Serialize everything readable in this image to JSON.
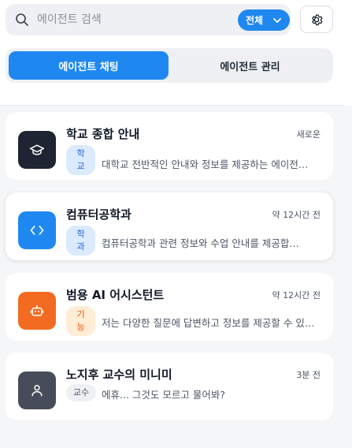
{
  "search": {
    "placeholder": "에이전트 검색",
    "filter_label": "전체"
  },
  "tabs": [
    {
      "label": "에이전트 채팅",
      "active": true
    },
    {
      "label": "에이전트 관리",
      "active": false
    }
  ],
  "agents": [
    {
      "title": "학교 종합 안내",
      "time": "새로운",
      "tag": "학교",
      "description": "대학교 전반적인 안내와 정보를 제공하는 에이전…",
      "icon": "graduation-cap-icon",
      "avatar_color": "#1f2433",
      "tag_style": "blue"
    },
    {
      "title": "컴퓨터공학과",
      "time": "약 12시간 전",
      "tag": "학과",
      "description": "컴퓨터공학과 관련 정보와 수업 안내를 제공합…",
      "icon": "code-icon",
      "avatar_color": "#1e88f0",
      "tag_style": "blue"
    },
    {
      "title": "범용 AI 어시스턴트",
      "time": "약 12시간 전",
      "tag": "기능",
      "description": "저는 다양한 질문에 답변하고 정보를 제공할 수 있…",
      "icon": "robot-icon",
      "avatar_color": "#f26b21",
      "tag_style": "orange"
    },
    {
      "title": "노지후 교수의 미니미",
      "time": "3분 전",
      "tag": "교수",
      "description": "에휴... 그것도 모르고 물어봐?",
      "icon": "user-icon",
      "avatar_color": "#464c59",
      "tag_style": "gray"
    }
  ],
  "icons": {
    "search": "search-icon",
    "filter": "chevron-down-icon",
    "settings": "gear-icon"
  },
  "colors": {
    "accent": "#1e88f0"
  }
}
